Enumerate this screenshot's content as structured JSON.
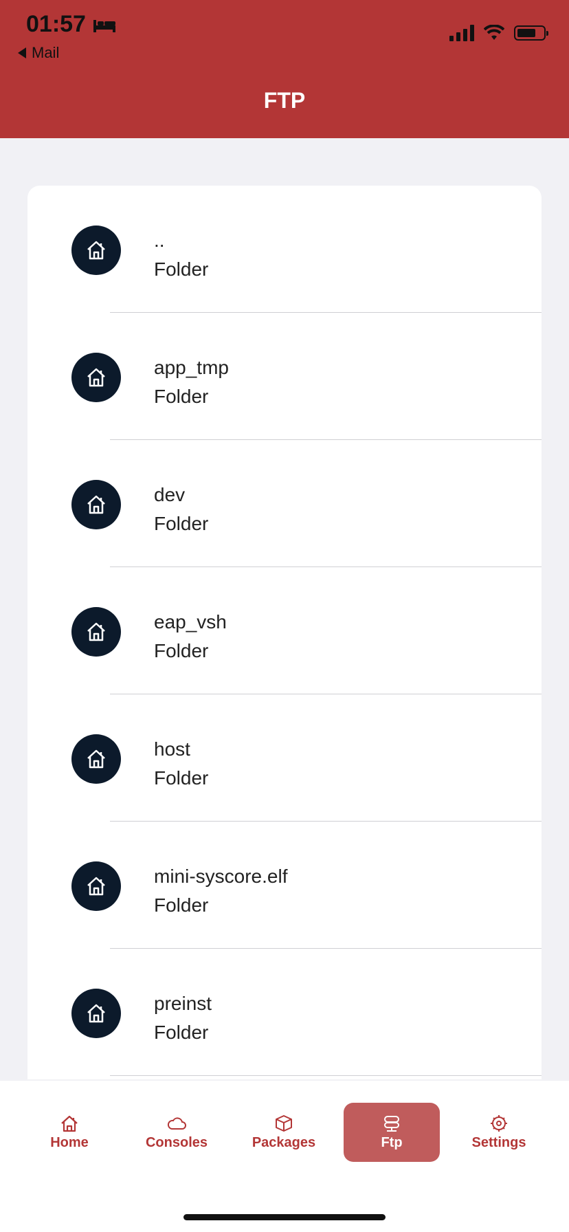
{
  "status": {
    "time": "01:57",
    "back_label": "Mail"
  },
  "header": {
    "title": "FTP"
  },
  "files": [
    {
      "name": "..",
      "type": "Folder"
    },
    {
      "name": "app_tmp",
      "type": "Folder"
    },
    {
      "name": "dev",
      "type": "Folder"
    },
    {
      "name": "eap_vsh",
      "type": "Folder"
    },
    {
      "name": "host",
      "type": "Folder"
    },
    {
      "name": "mini-syscore.elf",
      "type": "Folder"
    },
    {
      "name": "preinst",
      "type": "Folder"
    }
  ],
  "tabs": [
    {
      "label": "Home",
      "icon": "home-icon"
    },
    {
      "label": "Consoles",
      "icon": "cloud-icon"
    },
    {
      "label": "Packages",
      "icon": "package-icon"
    },
    {
      "label": "Ftp",
      "icon": "server-icon"
    },
    {
      "label": "Settings",
      "icon": "gear-icon"
    }
  ],
  "colors": {
    "accent": "#b33636",
    "active_tab": "#c05c5c",
    "avatar": "#0c1a2b"
  }
}
